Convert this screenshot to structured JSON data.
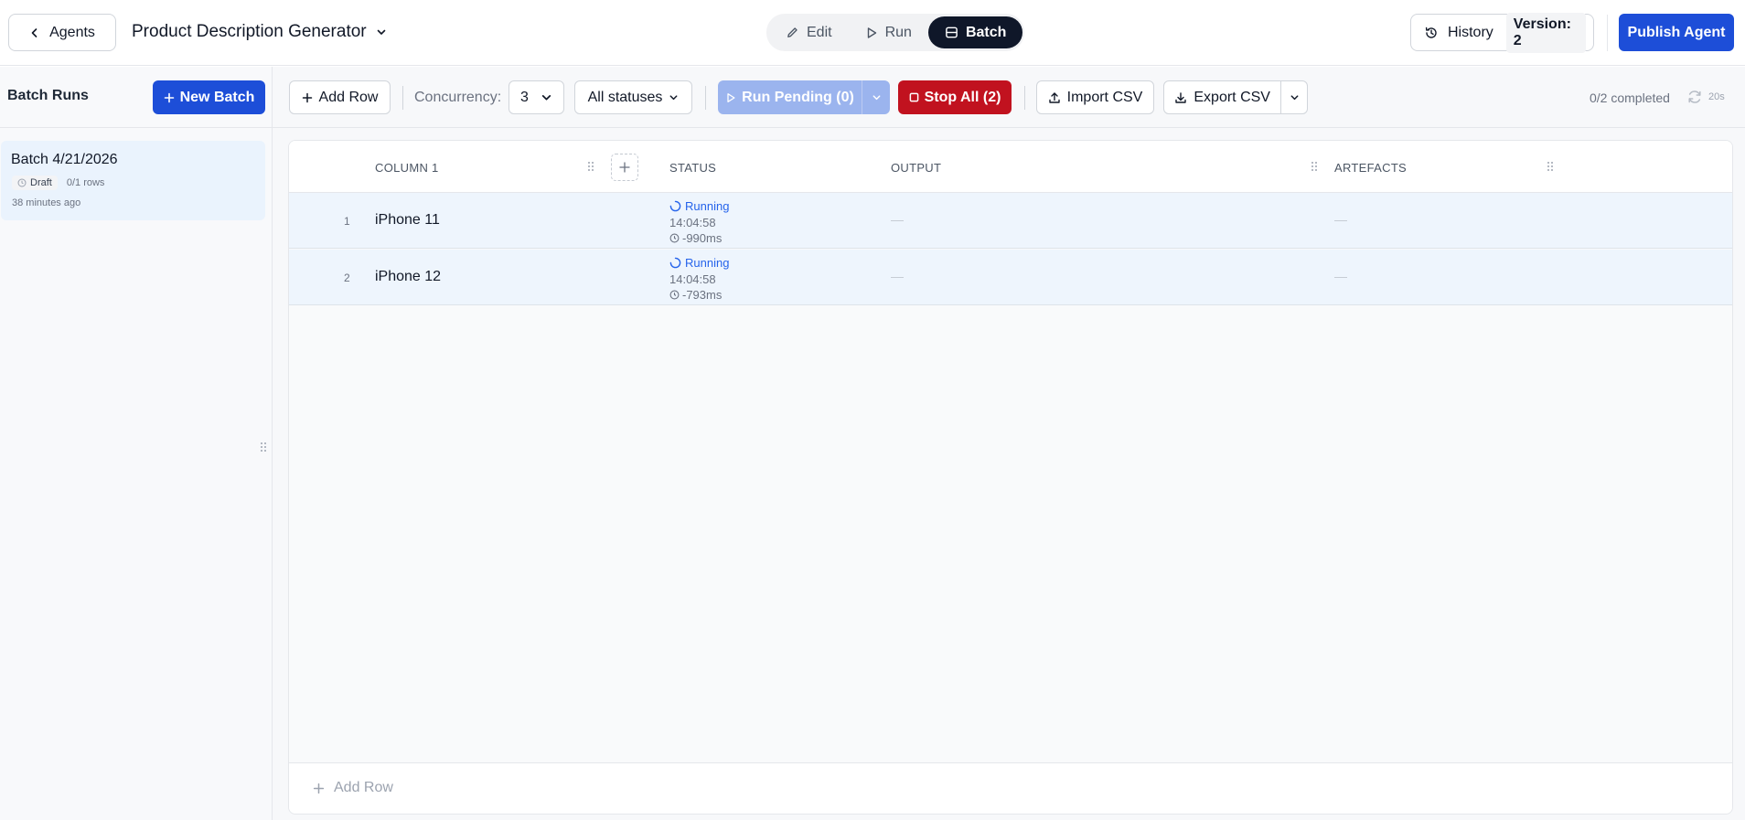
{
  "header": {
    "back_label": "Agents",
    "agent_title": "Product Description Generator",
    "modes": [
      {
        "label": "Edit",
        "icon": "pencil-icon"
      },
      {
        "label": "Run",
        "icon": "play-icon"
      },
      {
        "label": "Batch",
        "icon": "table-icon"
      }
    ],
    "active_mode": "Batch",
    "history_label": "History",
    "version_label": "Version: 2",
    "publish_label": "Publish Agent"
  },
  "sidebar": {
    "title": "Batch Runs",
    "new_batch_label": "New Batch",
    "batches": [
      {
        "name": "Batch 4/21/2026",
        "status": "Draft",
        "rows": "0/1 rows",
        "time": "38 minutes ago"
      }
    ]
  },
  "toolbar": {
    "add_row_label": "Add Row",
    "concurrency_label": "Concurrency:",
    "concurrency_value": "3",
    "status_filter": "All statuses",
    "run_pending_label": "Run Pending (0)",
    "stop_all_label": "Stop All (2)",
    "import_label": "Import CSV",
    "export_label": "Export CSV",
    "completed_text": "0/2 completed",
    "refresh_interval": "20s"
  },
  "table": {
    "columns": [
      "COLUMN 1",
      "STATUS",
      "OUTPUT",
      "ARTEFACTS"
    ],
    "rows": [
      {
        "num": "1",
        "value": "iPhone 11",
        "status": "Running",
        "time": "14:04:58",
        "duration": "-990ms",
        "output": "—",
        "artefacts": "—"
      },
      {
        "num": "2",
        "value": "iPhone 12",
        "status": "Running",
        "time": "14:04:58",
        "duration": "-793ms",
        "output": "—",
        "artefacts": "—"
      }
    ],
    "add_row_label": "Add Row"
  },
  "colors": {
    "primary": "#1d4ed8",
    "danger": "#c1121f",
    "running": "#2563eb",
    "active_mode": "#0f1729"
  }
}
